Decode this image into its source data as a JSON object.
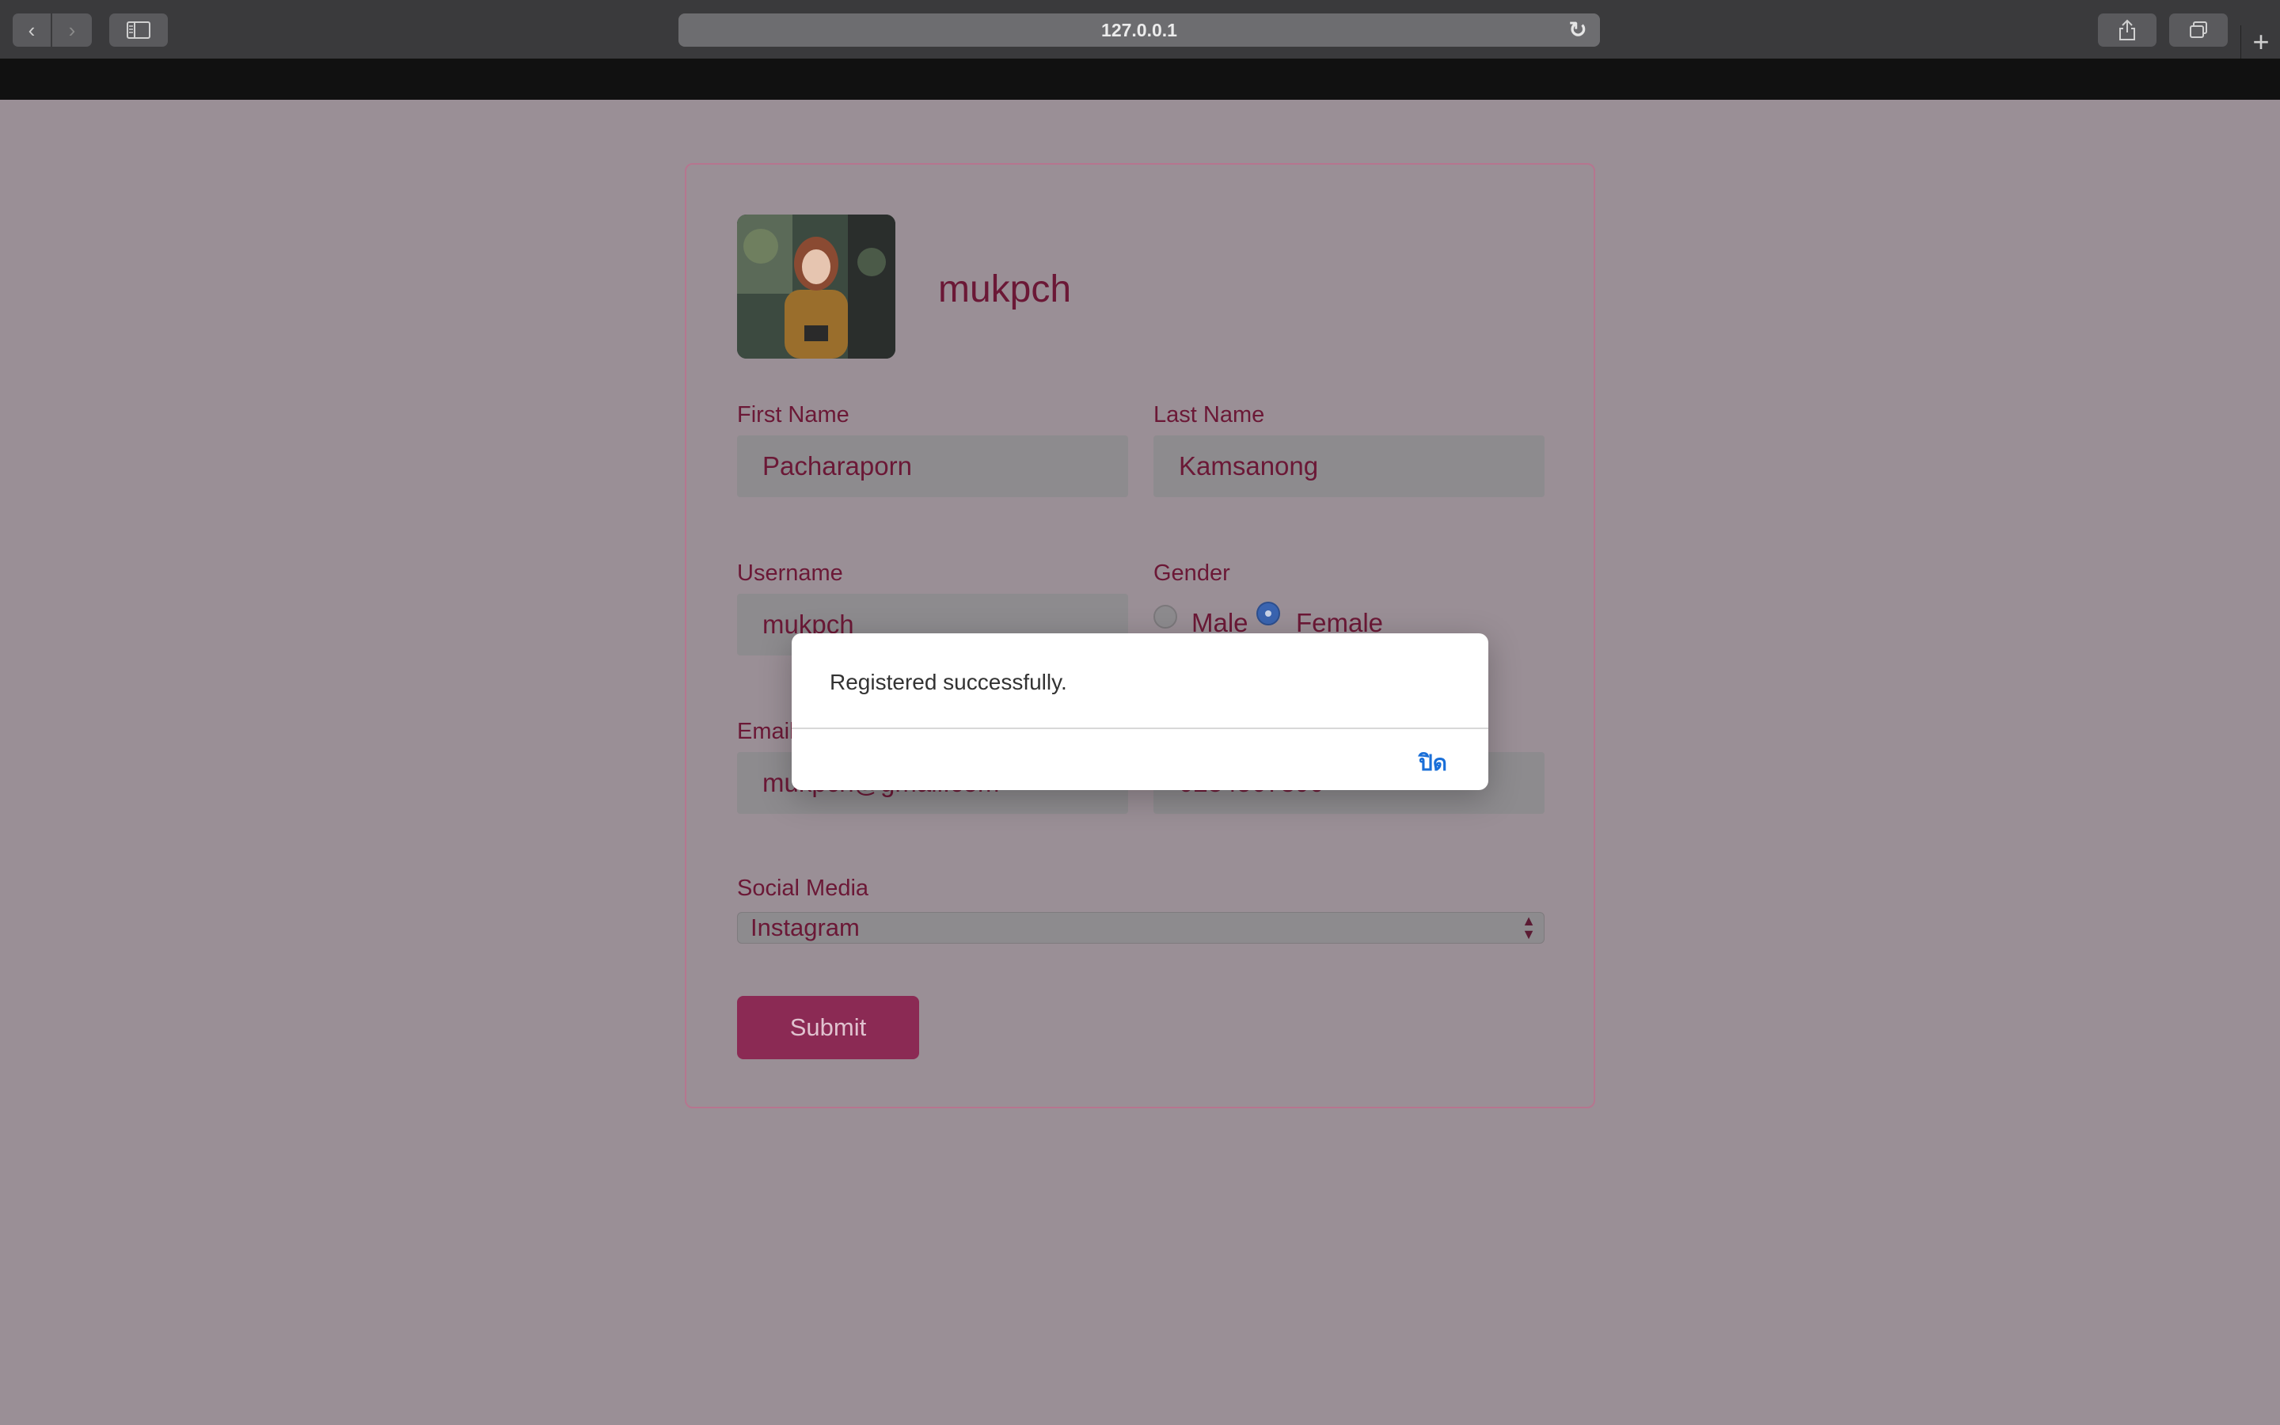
{
  "browser": {
    "url": "127.0.0.1"
  },
  "profile": {
    "display_name": "mukpch"
  },
  "form": {
    "first_name": {
      "label": "First Name",
      "value": "Pacharaporn"
    },
    "last_name": {
      "label": "Last Name",
      "value": "Kamsanong"
    },
    "username": {
      "label": "Username",
      "value": "mukpch"
    },
    "gender": {
      "label": "Gender",
      "options": [
        {
          "label": "Male",
          "selected": false
        },
        {
          "label": "Female",
          "selected": true
        }
      ]
    },
    "email": {
      "label": "Email",
      "value": "mukpch@gmail.com"
    },
    "phone": {
      "value": "0234567890"
    },
    "social_media": {
      "label": "Social Media",
      "value": "Instagram"
    },
    "submit_label": "Submit"
  },
  "dialog": {
    "message": "Registered successfully.",
    "close_label": "ปิด"
  },
  "icons": {
    "back": "chevron-left-icon",
    "forward": "chevron-right-icon",
    "sidebar": "sidebar-icon",
    "reload": "reload-icon",
    "share": "share-icon",
    "tabs": "tabs-icon",
    "new_tab": "plus-icon"
  },
  "colors": {
    "accent": "#8b2a54",
    "text": "#6b1836",
    "dialog_button": "#1a6fd8"
  }
}
